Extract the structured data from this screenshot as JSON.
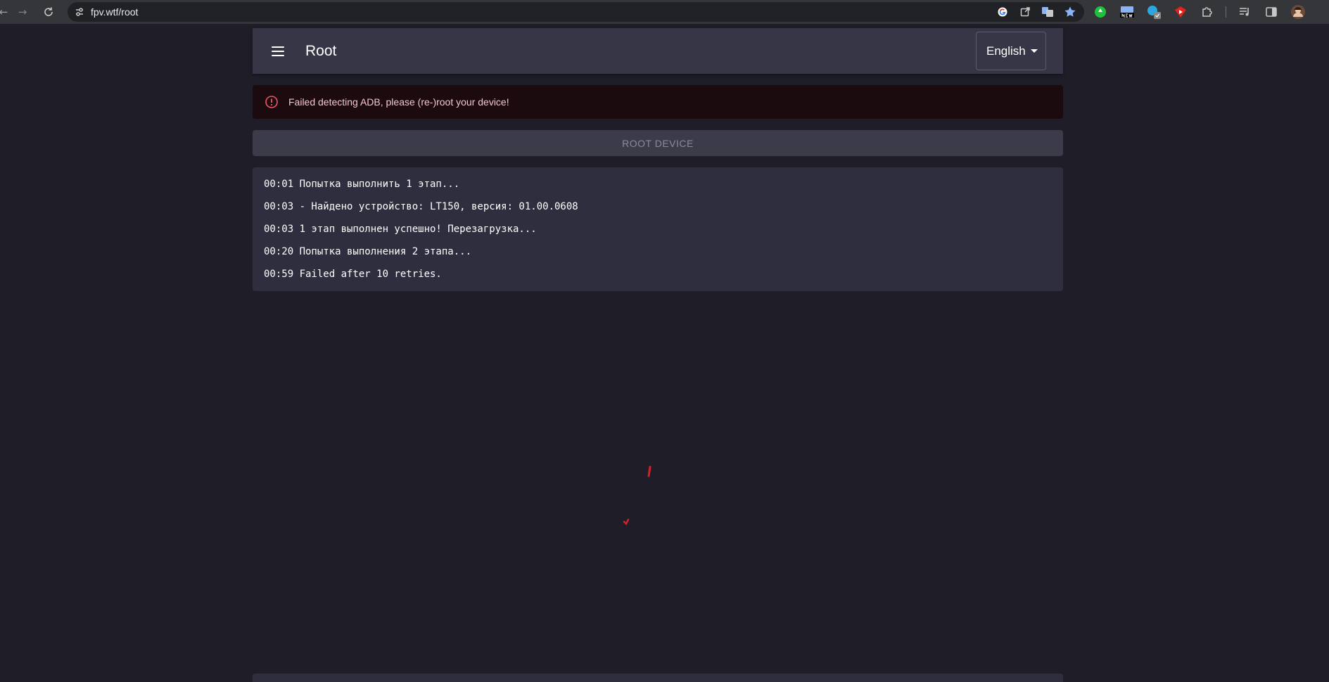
{
  "browser": {
    "url": "fpv.wtf/root",
    "back_icon": "arrow-left-icon",
    "forward_icon": "arrow-right-icon",
    "reload_icon": "reload-icon"
  },
  "header": {
    "title": "Root",
    "language": "English"
  },
  "alert": {
    "message": "Failed detecting ADB, please (re-)root your device!",
    "color": "#f4c7cf"
  },
  "root_button": {
    "label": "ROOT DEVICE"
  },
  "log": {
    "lines": [
      "00:01 Попытка выполнить 1 этап...",
      "00:03 - Найдено устройство: LT150, версия: 01.00.0608",
      "00:03 1 этап выполнен успешно! Перезагрузка...",
      "00:20 Попытка выполнения 2 этапа...",
      "00:59 Failed after 10 retries."
    ]
  },
  "colors": {
    "background": "#1f1e28",
    "panel": "#2e2e3f",
    "header": "#363646",
    "accent_red": "#d0212e"
  }
}
